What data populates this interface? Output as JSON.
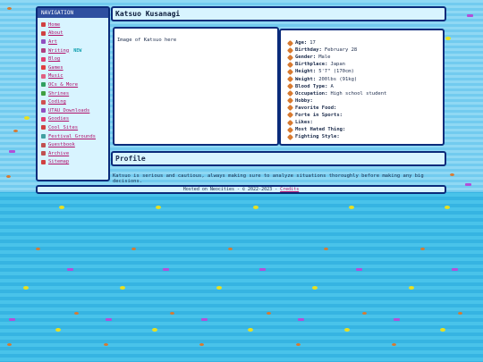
{
  "nav": {
    "title": "NAVIGATION",
    "items": [
      {
        "label": "Home",
        "icon": "house-icon",
        "color": "#d04040"
      },
      {
        "label": "About",
        "icon": "person-icon",
        "color": "#d04040"
      },
      {
        "label": "Art",
        "icon": "palette-icon",
        "color": "#9050c0"
      },
      {
        "label": "Writing",
        "icon": "pencil-icon",
        "color": "#b04080",
        "badge": "NEW"
      },
      {
        "label": "Blog",
        "icon": "heart-icon",
        "color": "#e04070"
      },
      {
        "label": "Games",
        "icon": "gamepad-icon",
        "color": "#e04040"
      },
      {
        "label": "Music",
        "icon": "note-icon",
        "color": "#e06080"
      },
      {
        "label": "OCs & More",
        "icon": "star-icon",
        "color": "#30a060"
      },
      {
        "label": "Shrines",
        "icon": "shrine-icon",
        "color": "#40a040"
      },
      {
        "label": "Coding",
        "icon": "code-icon",
        "color": "#d05050"
      },
      {
        "label": "UTAU Downloads",
        "icon": "download-icon",
        "color": "#9050c0"
      },
      {
        "label": "Goodies",
        "icon": "gift-icon",
        "color": "#e04070"
      },
      {
        "label": "Cool Sites",
        "icon": "globe-icon",
        "color": "#d04040"
      },
      {
        "label": "Festival Grounds",
        "icon": "tent-icon",
        "color": "#40a0a0"
      },
      {
        "label": "Guestbook",
        "icon": "book-icon",
        "color": "#c05050"
      },
      {
        "label": "Archive",
        "icon": "box-icon",
        "color": "#c05050"
      },
      {
        "label": "Sitemap",
        "icon": "map-icon",
        "color": "#d04040"
      }
    ]
  },
  "page": {
    "title": "Katsuo Kusanagi",
    "image_alt": "Image of Katsuo here",
    "profile_heading": "Profile",
    "profile_text": "Katsuo is serious and cautious, always making sure to analyze situations thoroughly before making any big decisions."
  },
  "stats": [
    {
      "key": "Age:",
      "value": "17"
    },
    {
      "key": "Birthday:",
      "value": "February 28"
    },
    {
      "key": "Gender:",
      "value": "Male"
    },
    {
      "key": "Birthplace:",
      "value": "Japan"
    },
    {
      "key": "Height:",
      "value": "5'7\" (170cm)"
    },
    {
      "key": "Weight:",
      "value": "200lbs (91kg)"
    },
    {
      "key": "Blood Type:",
      "value": "A"
    },
    {
      "key": "Occupation:",
      "value": "High school student"
    },
    {
      "key": "Hobby:",
      "value": ""
    },
    {
      "key": "Favorite Food:",
      "value": ""
    },
    {
      "key": "Forte in Sports:",
      "value": ""
    },
    {
      "key": "Likes:",
      "value": ""
    },
    {
      "key": "Most Hated Thing:",
      "value": ""
    },
    {
      "key": "Fighting Style:",
      "value": ""
    }
  ],
  "footer": {
    "text": "Hosted on Neocities - © 2022-2023 - ",
    "link": "Credits"
  }
}
